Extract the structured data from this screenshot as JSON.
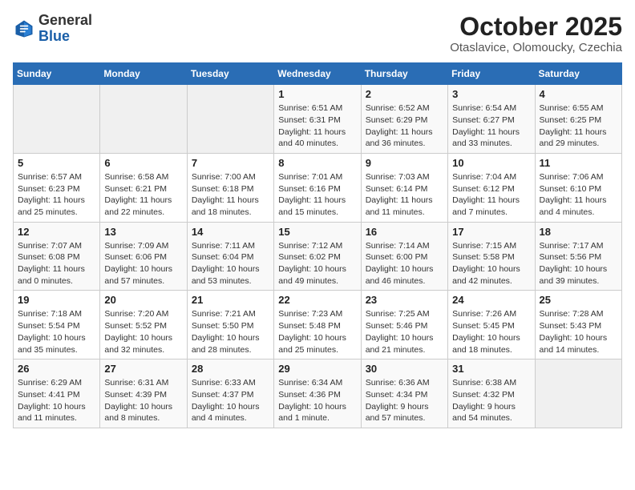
{
  "header": {
    "logo_general": "General",
    "logo_blue": "Blue",
    "month_title": "October 2025",
    "location": "Otaslavice, Olomoucky, Czechia"
  },
  "weekdays": [
    "Sunday",
    "Monday",
    "Tuesday",
    "Wednesday",
    "Thursday",
    "Friday",
    "Saturday"
  ],
  "weeks": [
    [
      {
        "day": "",
        "info": ""
      },
      {
        "day": "",
        "info": ""
      },
      {
        "day": "",
        "info": ""
      },
      {
        "day": "1",
        "info": "Sunrise: 6:51 AM\nSunset: 6:31 PM\nDaylight: 11 hours\nand 40 minutes."
      },
      {
        "day": "2",
        "info": "Sunrise: 6:52 AM\nSunset: 6:29 PM\nDaylight: 11 hours\nand 36 minutes."
      },
      {
        "day": "3",
        "info": "Sunrise: 6:54 AM\nSunset: 6:27 PM\nDaylight: 11 hours\nand 33 minutes."
      },
      {
        "day": "4",
        "info": "Sunrise: 6:55 AM\nSunset: 6:25 PM\nDaylight: 11 hours\nand 29 minutes."
      }
    ],
    [
      {
        "day": "5",
        "info": "Sunrise: 6:57 AM\nSunset: 6:23 PM\nDaylight: 11 hours\nand 25 minutes."
      },
      {
        "day": "6",
        "info": "Sunrise: 6:58 AM\nSunset: 6:21 PM\nDaylight: 11 hours\nand 22 minutes."
      },
      {
        "day": "7",
        "info": "Sunrise: 7:00 AM\nSunset: 6:18 PM\nDaylight: 11 hours\nand 18 minutes."
      },
      {
        "day": "8",
        "info": "Sunrise: 7:01 AM\nSunset: 6:16 PM\nDaylight: 11 hours\nand 15 minutes."
      },
      {
        "day": "9",
        "info": "Sunrise: 7:03 AM\nSunset: 6:14 PM\nDaylight: 11 hours\nand 11 minutes."
      },
      {
        "day": "10",
        "info": "Sunrise: 7:04 AM\nSunset: 6:12 PM\nDaylight: 11 hours\nand 7 minutes."
      },
      {
        "day": "11",
        "info": "Sunrise: 7:06 AM\nSunset: 6:10 PM\nDaylight: 11 hours\nand 4 minutes."
      }
    ],
    [
      {
        "day": "12",
        "info": "Sunrise: 7:07 AM\nSunset: 6:08 PM\nDaylight: 11 hours\nand 0 minutes."
      },
      {
        "day": "13",
        "info": "Sunrise: 7:09 AM\nSunset: 6:06 PM\nDaylight: 10 hours\nand 57 minutes."
      },
      {
        "day": "14",
        "info": "Sunrise: 7:11 AM\nSunset: 6:04 PM\nDaylight: 10 hours\nand 53 minutes."
      },
      {
        "day": "15",
        "info": "Sunrise: 7:12 AM\nSunset: 6:02 PM\nDaylight: 10 hours\nand 49 minutes."
      },
      {
        "day": "16",
        "info": "Sunrise: 7:14 AM\nSunset: 6:00 PM\nDaylight: 10 hours\nand 46 minutes."
      },
      {
        "day": "17",
        "info": "Sunrise: 7:15 AM\nSunset: 5:58 PM\nDaylight: 10 hours\nand 42 minutes."
      },
      {
        "day": "18",
        "info": "Sunrise: 7:17 AM\nSunset: 5:56 PM\nDaylight: 10 hours\nand 39 minutes."
      }
    ],
    [
      {
        "day": "19",
        "info": "Sunrise: 7:18 AM\nSunset: 5:54 PM\nDaylight: 10 hours\nand 35 minutes."
      },
      {
        "day": "20",
        "info": "Sunrise: 7:20 AM\nSunset: 5:52 PM\nDaylight: 10 hours\nand 32 minutes."
      },
      {
        "day": "21",
        "info": "Sunrise: 7:21 AM\nSunset: 5:50 PM\nDaylight: 10 hours\nand 28 minutes."
      },
      {
        "day": "22",
        "info": "Sunrise: 7:23 AM\nSunset: 5:48 PM\nDaylight: 10 hours\nand 25 minutes."
      },
      {
        "day": "23",
        "info": "Sunrise: 7:25 AM\nSunset: 5:46 PM\nDaylight: 10 hours\nand 21 minutes."
      },
      {
        "day": "24",
        "info": "Sunrise: 7:26 AM\nSunset: 5:45 PM\nDaylight: 10 hours\nand 18 minutes."
      },
      {
        "day": "25",
        "info": "Sunrise: 7:28 AM\nSunset: 5:43 PM\nDaylight: 10 hours\nand 14 minutes."
      }
    ],
    [
      {
        "day": "26",
        "info": "Sunrise: 6:29 AM\nSunset: 4:41 PM\nDaylight: 10 hours\nand 11 minutes."
      },
      {
        "day": "27",
        "info": "Sunrise: 6:31 AM\nSunset: 4:39 PM\nDaylight: 10 hours\nand 8 minutes."
      },
      {
        "day": "28",
        "info": "Sunrise: 6:33 AM\nSunset: 4:37 PM\nDaylight: 10 hours\nand 4 minutes."
      },
      {
        "day": "29",
        "info": "Sunrise: 6:34 AM\nSunset: 4:36 PM\nDaylight: 10 hours\nand 1 minute."
      },
      {
        "day": "30",
        "info": "Sunrise: 6:36 AM\nSunset: 4:34 PM\nDaylight: 9 hours\nand 57 minutes."
      },
      {
        "day": "31",
        "info": "Sunrise: 6:38 AM\nSunset: 4:32 PM\nDaylight: 9 hours\nand 54 minutes."
      },
      {
        "day": "",
        "info": ""
      }
    ]
  ]
}
